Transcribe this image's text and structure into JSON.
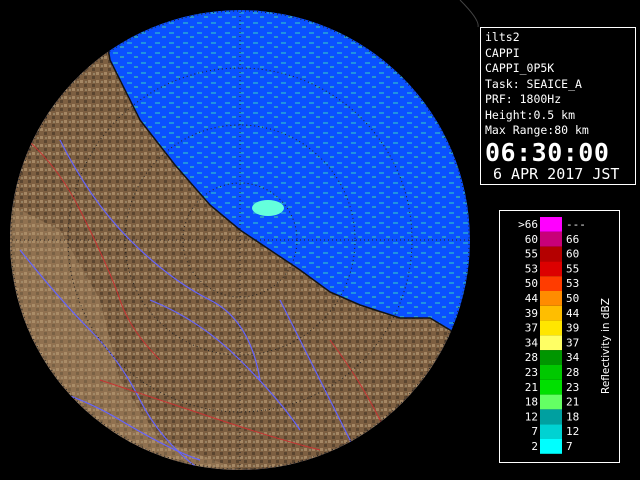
{
  "info": {
    "lines": [
      "ilts2",
      "CAPPI",
      "CAPPI_0P5K",
      "Task: SEAICE_A",
      "PRF: 1800Hz",
      "Height:0.5 km",
      "Max Range:80 km"
    ],
    "time": "06:30:00",
    "date": "6 APR 2017 JST"
  },
  "legend": {
    "title": "Reflectivity in dBZ",
    "rows": [
      {
        "low": ">66",
        "high": "---",
        "color": "#ff00ff"
      },
      {
        "low": "60",
        "high": "66",
        "color": "#c80078"
      },
      {
        "low": "55",
        "high": "60",
        "color": "#b40000"
      },
      {
        "low": "53",
        "high": "55",
        "color": "#dc0000"
      },
      {
        "low": "50",
        "high": "53",
        "color": "#ff3c00"
      },
      {
        "low": "44",
        "high": "50",
        "color": "#ff8c00"
      },
      {
        "low": "39",
        "high": "44",
        "color": "#ffbe00"
      },
      {
        "low": "37",
        "high": "39",
        "color": "#ffe600"
      },
      {
        "low": "34",
        "high": "37",
        "color": "#ffff64"
      },
      {
        "low": "28",
        "high": "34",
        "color": "#009600"
      },
      {
        "low": "23",
        "high": "28",
        "color": "#00c800"
      },
      {
        "low": "21",
        "high": "23",
        "color": "#00e000"
      },
      {
        "low": "18",
        "high": "21",
        "color": "#64ff64"
      },
      {
        "low": "12",
        "high": "18",
        "color": "#00a0a0"
      },
      {
        "low": "7",
        "high": "12",
        "color": "#00d2d2"
      },
      {
        "low": "2",
        "high": "7",
        "color": "#00ffff"
      }
    ]
  },
  "map": {
    "colors": {
      "sea": "#0a50ff",
      "terrain": "#826446",
      "terrain_light": "#b4966e",
      "echo": "#32c8c8",
      "river": "#6464ff",
      "border": "#c83232"
    }
  }
}
